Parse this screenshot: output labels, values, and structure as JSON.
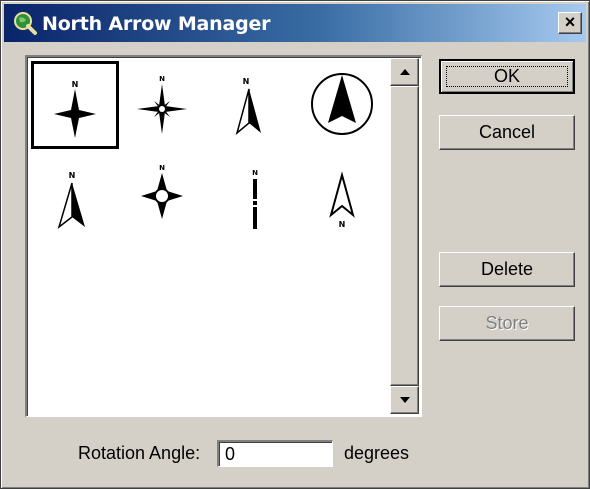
{
  "window": {
    "title": "North Arrow Manager",
    "close_label": "×"
  },
  "gallery": {
    "items": [
      {
        "icon": "north-arrow-4-point-star",
        "label": "N",
        "selected": true
      },
      {
        "icon": "north-arrow-8-point-compass-rose",
        "label": "N"
      },
      {
        "icon": "north-arrow-split-arrowhead",
        "label": "N"
      },
      {
        "icon": "north-arrow-circle-arrowhead",
        "label": ""
      },
      {
        "icon": "north-arrow-split-arrow-small",
        "label": "N"
      },
      {
        "icon": "north-arrow-diamond-compass",
        "label": "N"
      },
      {
        "icon": "north-arrow-thin-bar",
        "label": "N"
      },
      {
        "icon": "north-arrow-outline-arrowhead",
        "label": "N"
      }
    ]
  },
  "buttons": {
    "ok": "OK",
    "cancel": "Cancel",
    "delete": "Delete",
    "store": "Store"
  },
  "rotation": {
    "label": "Rotation Angle:",
    "value": "0",
    "unit": "degrees"
  }
}
